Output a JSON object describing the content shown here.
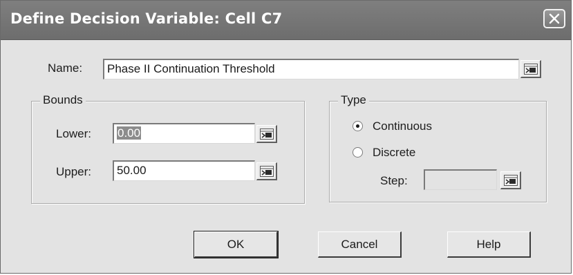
{
  "window": {
    "title": "Define Decision Variable: Cell C7"
  },
  "name_field": {
    "label": "Name:",
    "value": "Phase II Continuation Threshold"
  },
  "bounds": {
    "title": "Bounds",
    "lower_label": "Lower:",
    "lower_value": "0.00",
    "upper_label": "Upper:",
    "upper_value": "50.00"
  },
  "type": {
    "title": "Type",
    "options": [
      {
        "label": "Continuous",
        "selected": true
      },
      {
        "label": "Discrete",
        "selected": false
      }
    ],
    "step_label": "Step:",
    "step_value": ""
  },
  "buttons": {
    "ok": "OK",
    "cancel": "Cancel",
    "help": "Help"
  },
  "icons": {
    "close": "close-icon",
    "cell_reference": "cell-reference-icon",
    "radio_selected": "radio-selected-icon"
  },
  "colors": {
    "titlebar": "#737373",
    "dialog_bg": "#e3e3e3",
    "selection": "#8c8c8c"
  }
}
